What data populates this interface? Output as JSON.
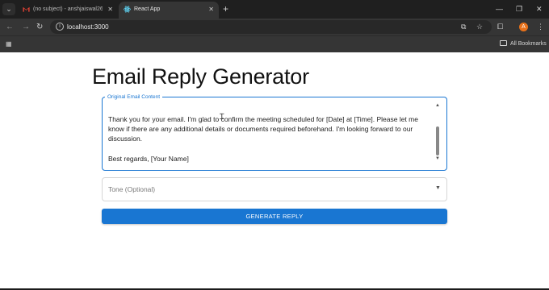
{
  "browser": {
    "tabs": [
      {
        "label": "(no subject) - anshjaiswal26@g",
        "favicon": "gmail-icon"
      },
      {
        "label": "React App",
        "favicon": "react-icon",
        "active": true
      }
    ],
    "url": "localhost:3000",
    "bookmarks_label": "All Bookmarks",
    "profile_initial": "A"
  },
  "page": {
    "title": "Email Reply Generator",
    "email_field": {
      "label": "Original Email Content",
      "lines": [
        "Thank you for your email. I'm glad to confirm the meeting scheduled for [Date] at [Time]. Please let me",
        "know if there are any additional details or documents required beforehand. I'm looking forward to our",
        "discussion.",
        "",
        "Best regards, [Your Name]"
      ]
    },
    "tone_field": {
      "label": "Tone (Optional)"
    },
    "generate_button": "GENERATE REPLY"
  },
  "colors": {
    "accent": "#1976d2",
    "chrome_dark": "#1f1f1f",
    "chrome": "#353535"
  }
}
